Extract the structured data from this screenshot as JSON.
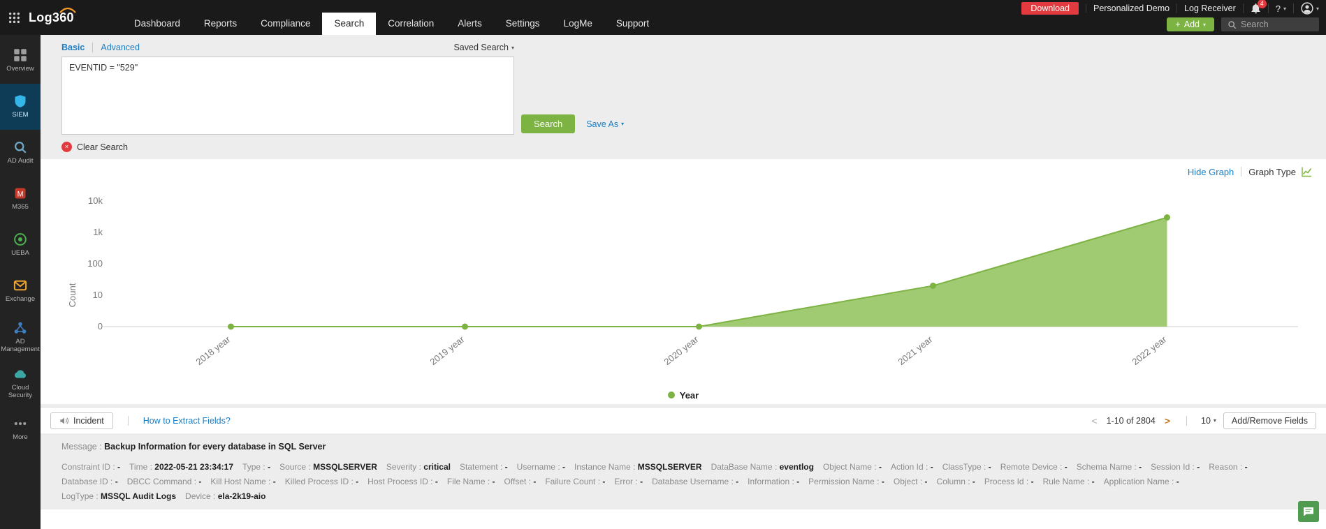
{
  "colors": {
    "accent_green": "#7cb342",
    "link_blue": "#1c7ec3",
    "alert_red": "#e23b3f"
  },
  "icons": {
    "caret_down": "▾",
    "chevron_left": "<",
    "chevron_right": ">",
    "plus": "+",
    "close": "×"
  },
  "header": {
    "logo_text": "Log360",
    "nav_items": [
      {
        "label": "Dashboard",
        "active": false
      },
      {
        "label": "Reports",
        "active": false
      },
      {
        "label": "Compliance",
        "active": false
      },
      {
        "label": "Search",
        "active": true
      },
      {
        "label": "Correlation",
        "active": false
      },
      {
        "label": "Alerts",
        "active": false
      },
      {
        "label": "Settings",
        "active": false
      },
      {
        "label": "LogMe",
        "active": false
      },
      {
        "label": "Support",
        "active": false
      }
    ],
    "download_label": "Download",
    "personalized_demo_label": "Personalized Demo",
    "log_receiver_label": "Log Receiver",
    "notification_count": "4",
    "help_label": "?",
    "add_button_label": "Add",
    "search_placeholder": "Search"
  },
  "sidebar": {
    "items": [
      {
        "label": "Overview",
        "icon": "grid-icon",
        "icon_color": "#9e9e9e",
        "active": false
      },
      {
        "label": "SIEM",
        "icon": "shield-icon",
        "icon_color": "#35b6e8",
        "active": true
      },
      {
        "label": "AD Audit",
        "icon": "audit-icon",
        "icon_color": "#6fa8c9",
        "active": false
      },
      {
        "label": "M365",
        "icon": "m365-icon",
        "icon_color": "#c0392b",
        "active": false
      },
      {
        "label": "UEBA",
        "icon": "ueba-icon",
        "icon_color": "#4caf50",
        "active": false
      },
      {
        "label": "Exchange",
        "icon": "mail-icon",
        "icon_color": "#f0a431",
        "active": false
      },
      {
        "label": "AD Management",
        "icon": "ad-management-icon",
        "icon_color": "#3f7fc1",
        "active": false
      },
      {
        "label": "Cloud Security",
        "icon": "cloud-icon",
        "icon_color": "#3aa7a3",
        "active": false
      },
      {
        "label": "More",
        "icon": "more-icon",
        "icon_color": "#9e9e9e",
        "active": false
      }
    ]
  },
  "search_panel": {
    "basic_tab": "Basic",
    "advanced_tab": "Advanced",
    "saved_search_label": "Saved Search",
    "query_value": "EVENTID = \"529\"",
    "search_button_label": "Search",
    "save_as_label": "Save As",
    "clear_search_label": "Clear Search"
  },
  "graph_panel": {
    "hide_graph_label": "Hide Graph",
    "graph_type_label": "Graph Type"
  },
  "chart_data": {
    "type": "area",
    "x": [
      "2018 year",
      "2019 year",
      "2020 year",
      "2021 year",
      "2022 year"
    ],
    "values": [
      0,
      0,
      0,
      20,
      3000
    ],
    "xlabel": "",
    "ylabel": "Count",
    "yscale": "log",
    "yticks": [
      0,
      10,
      100,
      1000,
      10000
    ],
    "ytick_labels": [
      "0",
      "10",
      "100",
      "1k",
      "10k"
    ],
    "fill_color": "#94c45e",
    "line_color": "#7cb342",
    "legend": [
      {
        "name": "Year",
        "color": "#7cb342"
      }
    ],
    "legend_position": "bottom-center",
    "grid": false
  },
  "results": {
    "incident_button_label": "Incident",
    "extract_fields_label": "How to Extract Fields?",
    "pagination_text": "1-10 of 2804",
    "page_size": "10",
    "add_remove_fields_label": "Add/Remove Fields",
    "record": {
      "message_label": "Message",
      "message_value": "Backup Information for every database in SQL Server",
      "field_rows": [
        [
          {
            "label": "Constraint ID",
            "value": "-"
          },
          {
            "label": "Time",
            "value": "2022-05-21 23:34:17"
          },
          {
            "label": "Type",
            "value": "-"
          },
          {
            "label": "Source",
            "value": "MSSQLSERVER"
          },
          {
            "label": "Severity",
            "value": "critical"
          },
          {
            "label": "Statement",
            "value": "-"
          },
          {
            "label": "Username",
            "value": "-"
          },
          {
            "label": "Instance Name",
            "value": "MSSQLSERVER"
          },
          {
            "label": "DataBase Name",
            "value": "eventlog"
          },
          {
            "label": "Object Name",
            "value": "-"
          },
          {
            "label": "Action Id",
            "value": "-"
          },
          {
            "label": "ClassType",
            "value": "-"
          },
          {
            "label": "Remote Device",
            "value": "-"
          },
          {
            "label": "Schema Name",
            "value": "-"
          },
          {
            "label": "Session Id",
            "value": "-"
          },
          {
            "label": "Reason",
            "value": "-"
          }
        ],
        [
          {
            "label": "Database ID",
            "value": "-"
          },
          {
            "label": "DBCC Command",
            "value": "-"
          },
          {
            "label": "Kill Host Name",
            "value": "-"
          },
          {
            "label": "Killed Process ID",
            "value": "-"
          },
          {
            "label": "Host Process ID",
            "value": "-"
          },
          {
            "label": "File Name",
            "value": "-"
          },
          {
            "label": "Offset",
            "value": "-"
          },
          {
            "label": "Failure Count",
            "value": "-"
          },
          {
            "label": "Error",
            "value": "-"
          },
          {
            "label": "Database Username",
            "value": "-"
          },
          {
            "label": "Information",
            "value": "-"
          },
          {
            "label": "Permission Name",
            "value": "-"
          },
          {
            "label": "Object",
            "value": "-"
          },
          {
            "label": "Column",
            "value": "-"
          },
          {
            "label": "Process Id",
            "value": "-"
          },
          {
            "label": "Rule Name",
            "value": "-"
          },
          {
            "label": "Application Name",
            "value": "-"
          }
        ],
        [
          {
            "label": "LogType",
            "value": "MSSQL Audit Logs"
          },
          {
            "label": "Device",
            "value": "ela-2k19-aio"
          }
        ]
      ]
    }
  }
}
